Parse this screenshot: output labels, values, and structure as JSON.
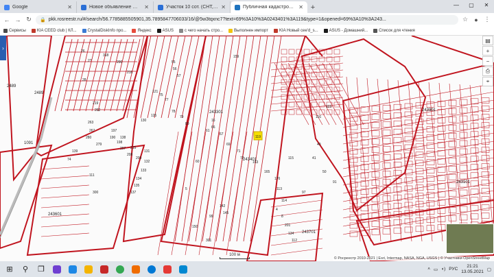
{
  "browser": {
    "tabs": [
      {
        "title": "Google",
        "color": "#4285f4",
        "active": false
      },
      {
        "title": "Новое объявление — Объявлени",
        "color": "#2b6fd6",
        "active": false
      },
      {
        "title": "Участок 10 сот. (СНТ, ДНП) на п",
        "color": "#2b6fd6",
        "active": false
      },
      {
        "title": "Публичная кадастровая карта",
        "color": "#1e73be",
        "active": true
      }
    ],
    "url": "pkk.rosreestr.ru/#/search/56.7785885505901,35.7895847706033/16/@5w3tqxnc7?text=69%3A10%3A0243401%3A119&type=1&opened=69%3A10%3A243..."
  },
  "bookmarks": [
    {
      "label": "Сервисы",
      "color": "#4a4a4a"
    },
    {
      "label": "KIA CEED club | КЛ...",
      "color": "#c0392b"
    },
    {
      "label": "CrystalDiskInfo про...",
      "color": "#3a7bd5"
    },
    {
      "label": "Яндекс",
      "color": "#e74c3c"
    },
    {
      "label": "ASUS",
      "color": "#1a1a1a"
    },
    {
      "label": "с чего начать стро...",
      "color": "#888888"
    },
    {
      "label": "Выполнен импорт",
      "color": "#f1c40f"
    },
    {
      "label": "KIA Новый cee'd_s...",
      "color": "#c0392b"
    },
    {
      "label": "ASUS - Домашний...",
      "color": "#1a1a1a"
    },
    {
      "label": "Список для чтения",
      "color": "#555555"
    }
  ],
  "map": {
    "parcel_color": "#c0141e",
    "highlight_color": "#f6e000",
    "highlight_label": "119",
    "scale_label": "100 м",
    "attribution": "© Росреестр 2010-2021 | Esri, Intermap, NASA, NGA, USGS | © Участники OpenStreetMap",
    "quarters": [
      "2489",
      "2489",
      "1091",
      "243301",
      "243401",
      "243701",
      "243901",
      "243101",
      "243601"
    ],
    "parcel_numbers": [
      "26",
      "27",
      "28",
      "318",
      "290",
      "216",
      "219",
      "262",
      "263",
      "267",
      "280",
      "279",
      "139",
      "190",
      "197",
      "198",
      "207",
      "208",
      "209",
      "215",
      "74",
      "75",
      "77",
      "78",
      "79",
      "80",
      "121",
      "125",
      "130",
      "131",
      "132",
      "133",
      "134",
      "135",
      "137",
      "138",
      "16",
      "5",
      "55",
      "56",
      "57",
      "60",
      "61",
      "66",
      "67",
      "69",
      "71",
      "72",
      "142",
      "145",
      "150",
      "159",
      "163",
      "165",
      "176",
      "4",
      "8",
      "201",
      "134",
      "112",
      "113",
      "114",
      "115",
      "116",
      "119",
      "40",
      "41",
      "50",
      "91",
      "97",
      "99",
      "111",
      "300",
      "301"
    ]
  },
  "taskbar": {
    "lang": "РУС",
    "time": "21:21",
    "date": "13.05.2021"
  }
}
